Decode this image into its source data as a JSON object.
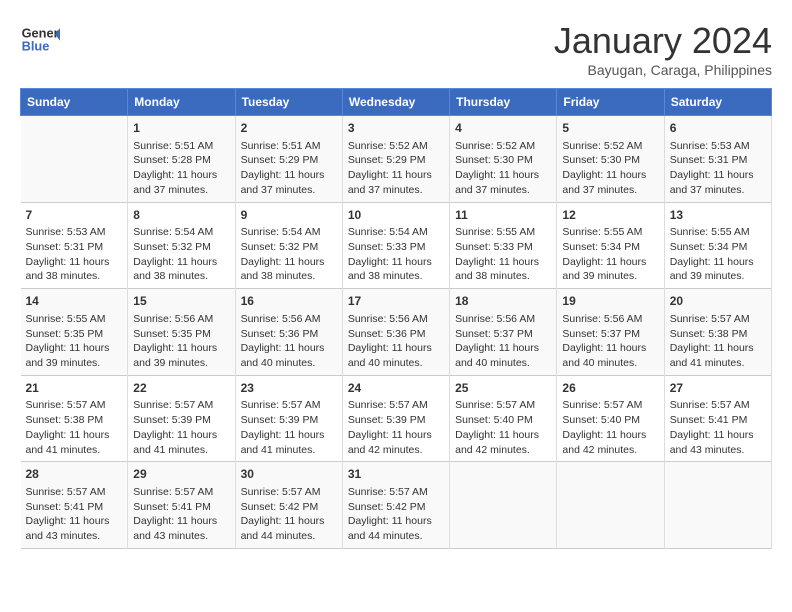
{
  "header": {
    "logo_line1": "General",
    "logo_line2": "Blue",
    "month": "January 2024",
    "location": "Bayugan, Caraga, Philippines"
  },
  "weekdays": [
    "Sunday",
    "Monday",
    "Tuesday",
    "Wednesday",
    "Thursday",
    "Friday",
    "Saturday"
  ],
  "weeks": [
    [
      {
        "day": "",
        "info": ""
      },
      {
        "day": "1",
        "info": "Sunrise: 5:51 AM\nSunset: 5:28 PM\nDaylight: 11 hours\nand 37 minutes."
      },
      {
        "day": "2",
        "info": "Sunrise: 5:51 AM\nSunset: 5:29 PM\nDaylight: 11 hours\nand 37 minutes."
      },
      {
        "day": "3",
        "info": "Sunrise: 5:52 AM\nSunset: 5:29 PM\nDaylight: 11 hours\nand 37 minutes."
      },
      {
        "day": "4",
        "info": "Sunrise: 5:52 AM\nSunset: 5:30 PM\nDaylight: 11 hours\nand 37 minutes."
      },
      {
        "day": "5",
        "info": "Sunrise: 5:52 AM\nSunset: 5:30 PM\nDaylight: 11 hours\nand 37 minutes."
      },
      {
        "day": "6",
        "info": "Sunrise: 5:53 AM\nSunset: 5:31 PM\nDaylight: 11 hours\nand 37 minutes."
      }
    ],
    [
      {
        "day": "7",
        "info": "Sunrise: 5:53 AM\nSunset: 5:31 PM\nDaylight: 11 hours\nand 38 minutes."
      },
      {
        "day": "8",
        "info": "Sunrise: 5:54 AM\nSunset: 5:32 PM\nDaylight: 11 hours\nand 38 minutes."
      },
      {
        "day": "9",
        "info": "Sunrise: 5:54 AM\nSunset: 5:32 PM\nDaylight: 11 hours\nand 38 minutes."
      },
      {
        "day": "10",
        "info": "Sunrise: 5:54 AM\nSunset: 5:33 PM\nDaylight: 11 hours\nand 38 minutes."
      },
      {
        "day": "11",
        "info": "Sunrise: 5:55 AM\nSunset: 5:33 PM\nDaylight: 11 hours\nand 38 minutes."
      },
      {
        "day": "12",
        "info": "Sunrise: 5:55 AM\nSunset: 5:34 PM\nDaylight: 11 hours\nand 39 minutes."
      },
      {
        "day": "13",
        "info": "Sunrise: 5:55 AM\nSunset: 5:34 PM\nDaylight: 11 hours\nand 39 minutes."
      }
    ],
    [
      {
        "day": "14",
        "info": "Sunrise: 5:55 AM\nSunset: 5:35 PM\nDaylight: 11 hours\nand 39 minutes."
      },
      {
        "day": "15",
        "info": "Sunrise: 5:56 AM\nSunset: 5:35 PM\nDaylight: 11 hours\nand 39 minutes."
      },
      {
        "day": "16",
        "info": "Sunrise: 5:56 AM\nSunset: 5:36 PM\nDaylight: 11 hours\nand 40 minutes."
      },
      {
        "day": "17",
        "info": "Sunrise: 5:56 AM\nSunset: 5:36 PM\nDaylight: 11 hours\nand 40 minutes."
      },
      {
        "day": "18",
        "info": "Sunrise: 5:56 AM\nSunset: 5:37 PM\nDaylight: 11 hours\nand 40 minutes."
      },
      {
        "day": "19",
        "info": "Sunrise: 5:56 AM\nSunset: 5:37 PM\nDaylight: 11 hours\nand 40 minutes."
      },
      {
        "day": "20",
        "info": "Sunrise: 5:57 AM\nSunset: 5:38 PM\nDaylight: 11 hours\nand 41 minutes."
      }
    ],
    [
      {
        "day": "21",
        "info": "Sunrise: 5:57 AM\nSunset: 5:38 PM\nDaylight: 11 hours\nand 41 minutes."
      },
      {
        "day": "22",
        "info": "Sunrise: 5:57 AM\nSunset: 5:39 PM\nDaylight: 11 hours\nand 41 minutes."
      },
      {
        "day": "23",
        "info": "Sunrise: 5:57 AM\nSunset: 5:39 PM\nDaylight: 11 hours\nand 41 minutes."
      },
      {
        "day": "24",
        "info": "Sunrise: 5:57 AM\nSunset: 5:39 PM\nDaylight: 11 hours\nand 42 minutes."
      },
      {
        "day": "25",
        "info": "Sunrise: 5:57 AM\nSunset: 5:40 PM\nDaylight: 11 hours\nand 42 minutes."
      },
      {
        "day": "26",
        "info": "Sunrise: 5:57 AM\nSunset: 5:40 PM\nDaylight: 11 hours\nand 42 minutes."
      },
      {
        "day": "27",
        "info": "Sunrise: 5:57 AM\nSunset: 5:41 PM\nDaylight: 11 hours\nand 43 minutes."
      }
    ],
    [
      {
        "day": "28",
        "info": "Sunrise: 5:57 AM\nSunset: 5:41 PM\nDaylight: 11 hours\nand 43 minutes."
      },
      {
        "day": "29",
        "info": "Sunrise: 5:57 AM\nSunset: 5:41 PM\nDaylight: 11 hours\nand 43 minutes."
      },
      {
        "day": "30",
        "info": "Sunrise: 5:57 AM\nSunset: 5:42 PM\nDaylight: 11 hours\nand 44 minutes."
      },
      {
        "day": "31",
        "info": "Sunrise: 5:57 AM\nSunset: 5:42 PM\nDaylight: 11 hours\nand 44 minutes."
      },
      {
        "day": "",
        "info": ""
      },
      {
        "day": "",
        "info": ""
      },
      {
        "day": "",
        "info": ""
      }
    ]
  ]
}
